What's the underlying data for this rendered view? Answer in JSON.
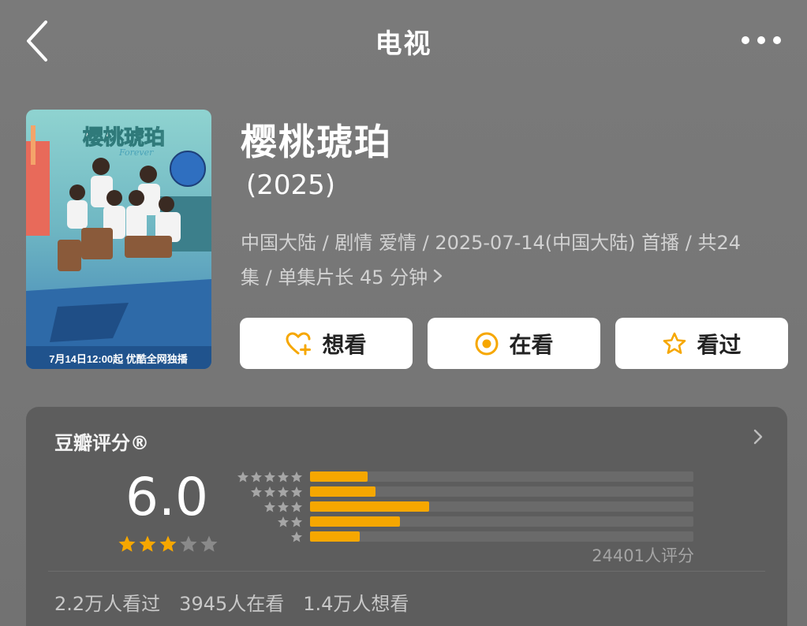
{
  "nav": {
    "title": "电视"
  },
  "poster": {
    "logo_text": "樱桃琥珀",
    "sub_text": "Forever",
    "banner": "7月14日12:00起  优酷全网独播"
  },
  "show": {
    "title": "樱桃琥珀",
    "year": "(2025)",
    "meta_line1": "中国大陆 / 剧情 爱情 / 2025-07-14(中国大陆) 首播 / 共24",
    "meta_line2": "集 / 单集片长 45 分钟"
  },
  "actions": {
    "want": "想看",
    "doing": "在看",
    "done": "看过"
  },
  "rating": {
    "label": "豆瓣评分®",
    "score": "6.0",
    "score_stars": 3,
    "distribution": [
      {
        "stars": 5,
        "percent": 15
      },
      {
        "stars": 4,
        "percent": 17
      },
      {
        "stars": 3,
        "percent": 31
      },
      {
        "stars": 2,
        "percent": 23.5
      },
      {
        "stars": 1,
        "percent": 13
      }
    ],
    "count_text": "24401人评分"
  },
  "stats": {
    "watched": "2.2万人看过",
    "watching": "3945人在看",
    "want": "1.4万人想看"
  },
  "colors": {
    "accent": "#f6a700",
    "card_bg": "#5d5d5d",
    "page_bg": "#7b7b7b"
  }
}
